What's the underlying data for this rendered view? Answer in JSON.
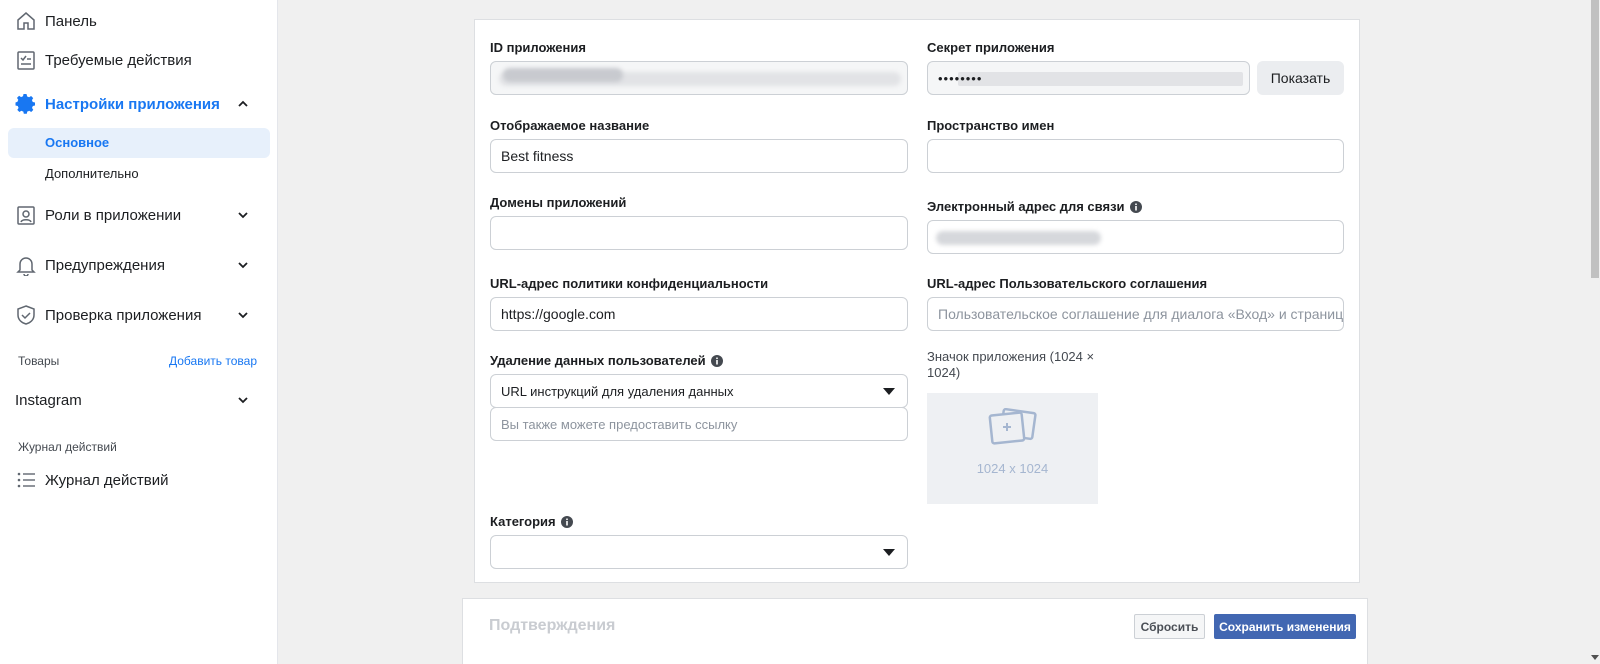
{
  "sidebar": {
    "dashboard": "Панель",
    "required_actions": "Требуемые действия",
    "app_settings": "Настройки приложения",
    "basic": "Основное",
    "advanced": "Дополнительно",
    "app_roles": "Роли в приложении",
    "alerts": "Предупреждения",
    "app_review": "Проверка приложения",
    "products_label": "Товары",
    "add_product": "Добавить товар",
    "instagram": "Instagram",
    "activity_log_section": "Журнал действий",
    "activity_log": "Журнал действий"
  },
  "form": {
    "app_id_label": "ID приложения",
    "app_secret_label": "Секрет приложения",
    "app_secret_value": "••••••••",
    "show_button": "Показать",
    "display_name_label": "Отображаемое название",
    "display_name_value": "Best fitness",
    "namespace_label": "Пространство имен",
    "namespace_value": "",
    "app_domains_label": "Домены приложений",
    "app_domains_value": "",
    "contact_email_label": "Электронный адрес для связи",
    "privacy_url_label": "URL-адрес политики конфиденциальности",
    "privacy_url_value": "https://google.com",
    "tos_url_label": "URL-адрес Пользовательского соглашения",
    "tos_url_placeholder": "Пользовательское соглашение для диалога «Вход» и страницы с",
    "data_deletion_label": "Удаление данных пользователей",
    "data_deletion_select": "URL инструкций для удаления данных",
    "data_deletion_placeholder": "Вы также можете предоставить ссылку",
    "app_icon_label": "Значок приложения (1024 × 1024)",
    "app_icon_size": "1024 x 1024",
    "category_label": "Категория",
    "category_value": ""
  },
  "footer": {
    "title": "Подтверждения",
    "reset": "Сбросить",
    "save": "Сохранить изменения"
  },
  "colors": {
    "accent": "#1877f2",
    "save_button": "#4267b2"
  }
}
